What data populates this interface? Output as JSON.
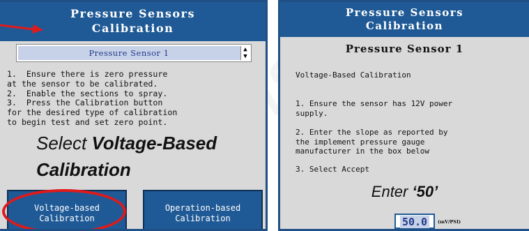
{
  "left": {
    "title_line1": "Pressure Sensors",
    "title_line2": "Calibration",
    "selector_value": "Pressure Sensor 1",
    "instructions": "1.  Ensure there is zero pressure\nat the sensor to be calibrated.\n2.  Enable the sections to spray.\n3.  Press the Calibration button\nfor the desired type of calibration\nto begin test and set zero point.",
    "callout_select": "Select",
    "callout_voltage_based": "Voltage-Based",
    "callout_calibration": "Calibration",
    "button_voltage_line1": "Voltage-based",
    "button_voltage_line2": "Calibration",
    "button_operation_line1": "Operation-based",
    "button_operation_line2": "Calibration"
  },
  "right": {
    "title_line1": "Pressure Sensors",
    "title_line2": "Calibration",
    "heading": "Pressure Sensor 1",
    "mode_label": "Voltage-Based Calibration",
    "step1": "1. Ensure the sensor has 12V power\nsupply.",
    "step2": "2. Enter the slope as reported by\nthe implement pressure gauge\nmanufacturer in the box below",
    "step3": "3. Select Accept",
    "callout_enter": "Enter",
    "callout_value": "‘50’",
    "slope_value": "50.0",
    "slope_unit": "(mV/PSI)"
  },
  "watermark": "ems",
  "colors": {
    "titlebar": "#1f5a96",
    "panel_bg": "#d9d9d9",
    "highlight_red": "#e01a1a",
    "field_bg": "#c7d1e8"
  }
}
